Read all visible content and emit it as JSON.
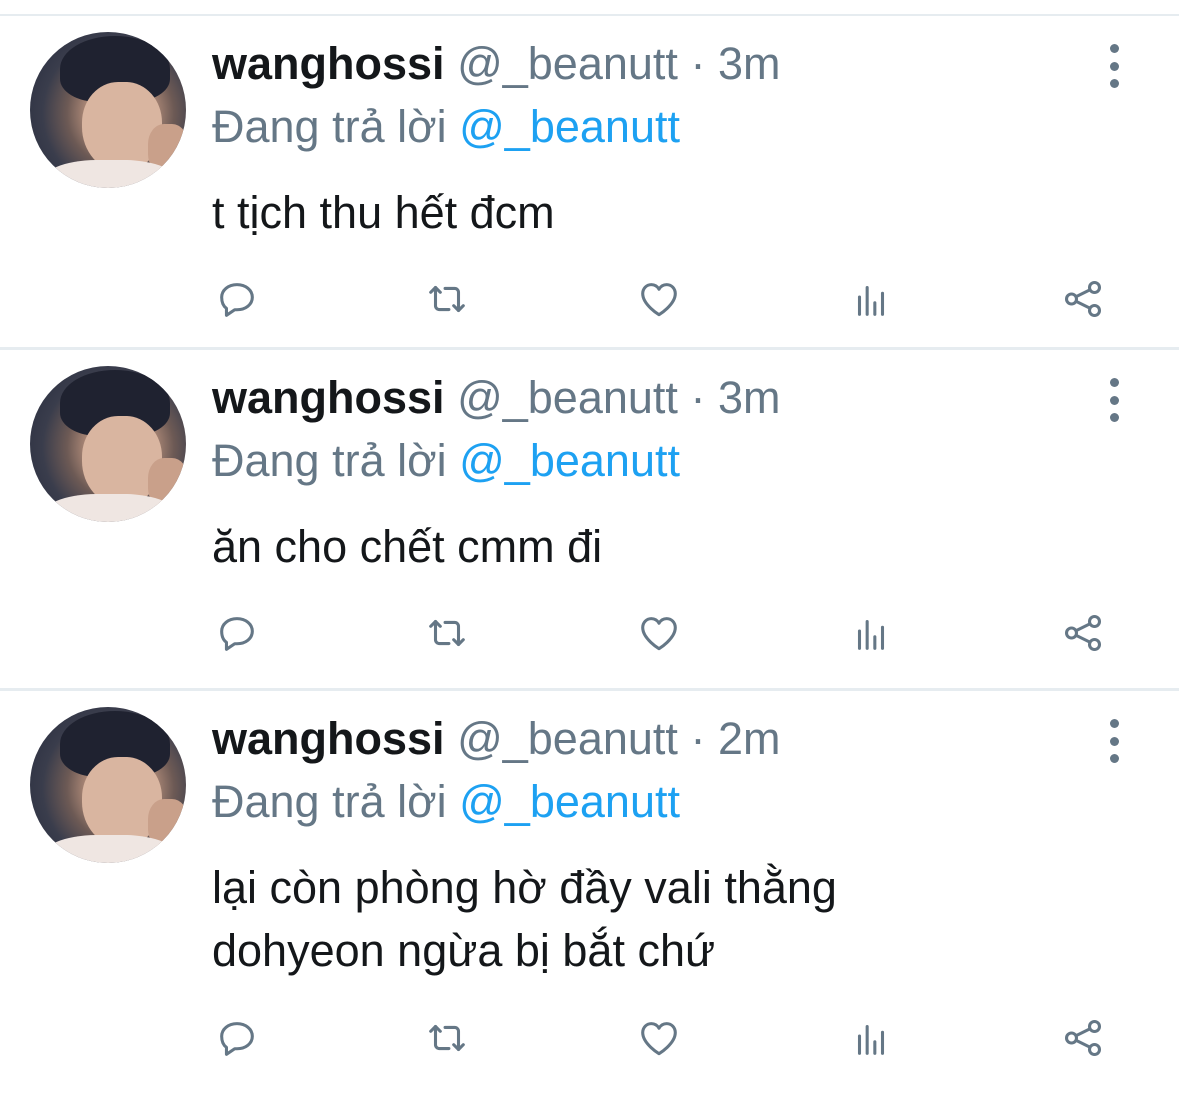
{
  "tweets": [
    {
      "name": "wanghossi",
      "handle": "@_beanutt",
      "separator": "·",
      "time": "3m",
      "reply_prefix": "Đang trả lời",
      "reply_to": "@_beanutt",
      "text": "t tịch thu hết đcm"
    },
    {
      "name": "wanghossi",
      "handle": "@_beanutt",
      "separator": "·",
      "time": "3m",
      "reply_prefix": "Đang trả lời",
      "reply_to": "@_beanutt",
      "text": "ăn cho chết cmm đi"
    },
    {
      "name": "wanghossi",
      "handle": "@_beanutt",
      "separator": "·",
      "time": "2m",
      "reply_prefix": "Đang trả lời",
      "reply_to": "@_beanutt",
      "text_lines": [
        "lại còn phòng hờ đầy vali thằng",
        "dohyeon ngừa bị bắt chứ"
      ]
    }
  ],
  "icons": {
    "more": "more-vertical-icon",
    "reply": "reply-icon",
    "retweet": "retweet-icon",
    "like": "heart-icon",
    "stats": "analytics-icon",
    "share": "share-icon"
  },
  "colors": {
    "text": "#14171a",
    "muted": "#657786",
    "accent": "#1da1f2",
    "divider": "#e6ecf0"
  }
}
